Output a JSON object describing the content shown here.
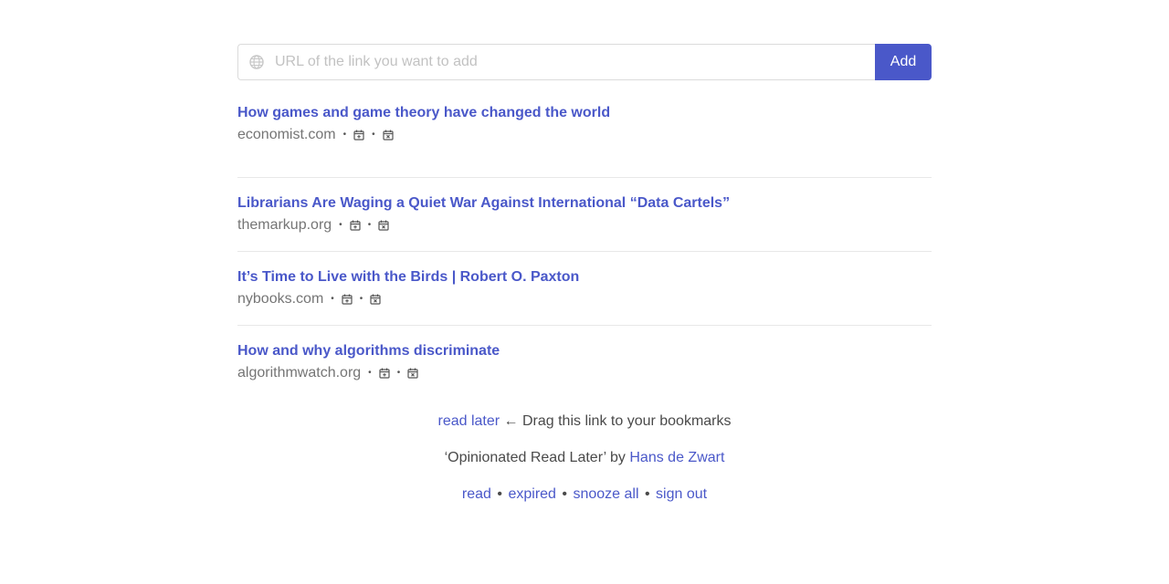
{
  "form": {
    "placeholder": "URL of the link you want to add",
    "add_label": "Add",
    "accent_color": "#4a58c9"
  },
  "links": [
    {
      "title": "How games and game theory have changed the world",
      "domain": "economist.com"
    },
    {
      "title": "Librarians Are Waging a Quiet War Against International “Data Cartels”",
      "domain": "themarkup.org"
    },
    {
      "title": "It’s Time to Live with the Birds | Robert O. Paxton",
      "domain": "nybooks.com"
    },
    {
      "title": "How and why algorithms discriminate",
      "domain": "algorithmwatch.org"
    }
  ],
  "meta_separator": "•",
  "icons": {
    "input": "globe-icon",
    "snooze": "calendar-plus-icon",
    "expire": "calendar-x-icon"
  },
  "footer": {
    "bookmarklet_link": "read later",
    "bookmarklet_text": "← Drag this link to your bookmarks",
    "credit_prefix": "‘Opinionated Read Later’ by",
    "credit_author": "Hans de Zwart",
    "nav": [
      "read",
      "expired",
      "snooze all",
      "sign out"
    ],
    "nav_separator": "•"
  }
}
